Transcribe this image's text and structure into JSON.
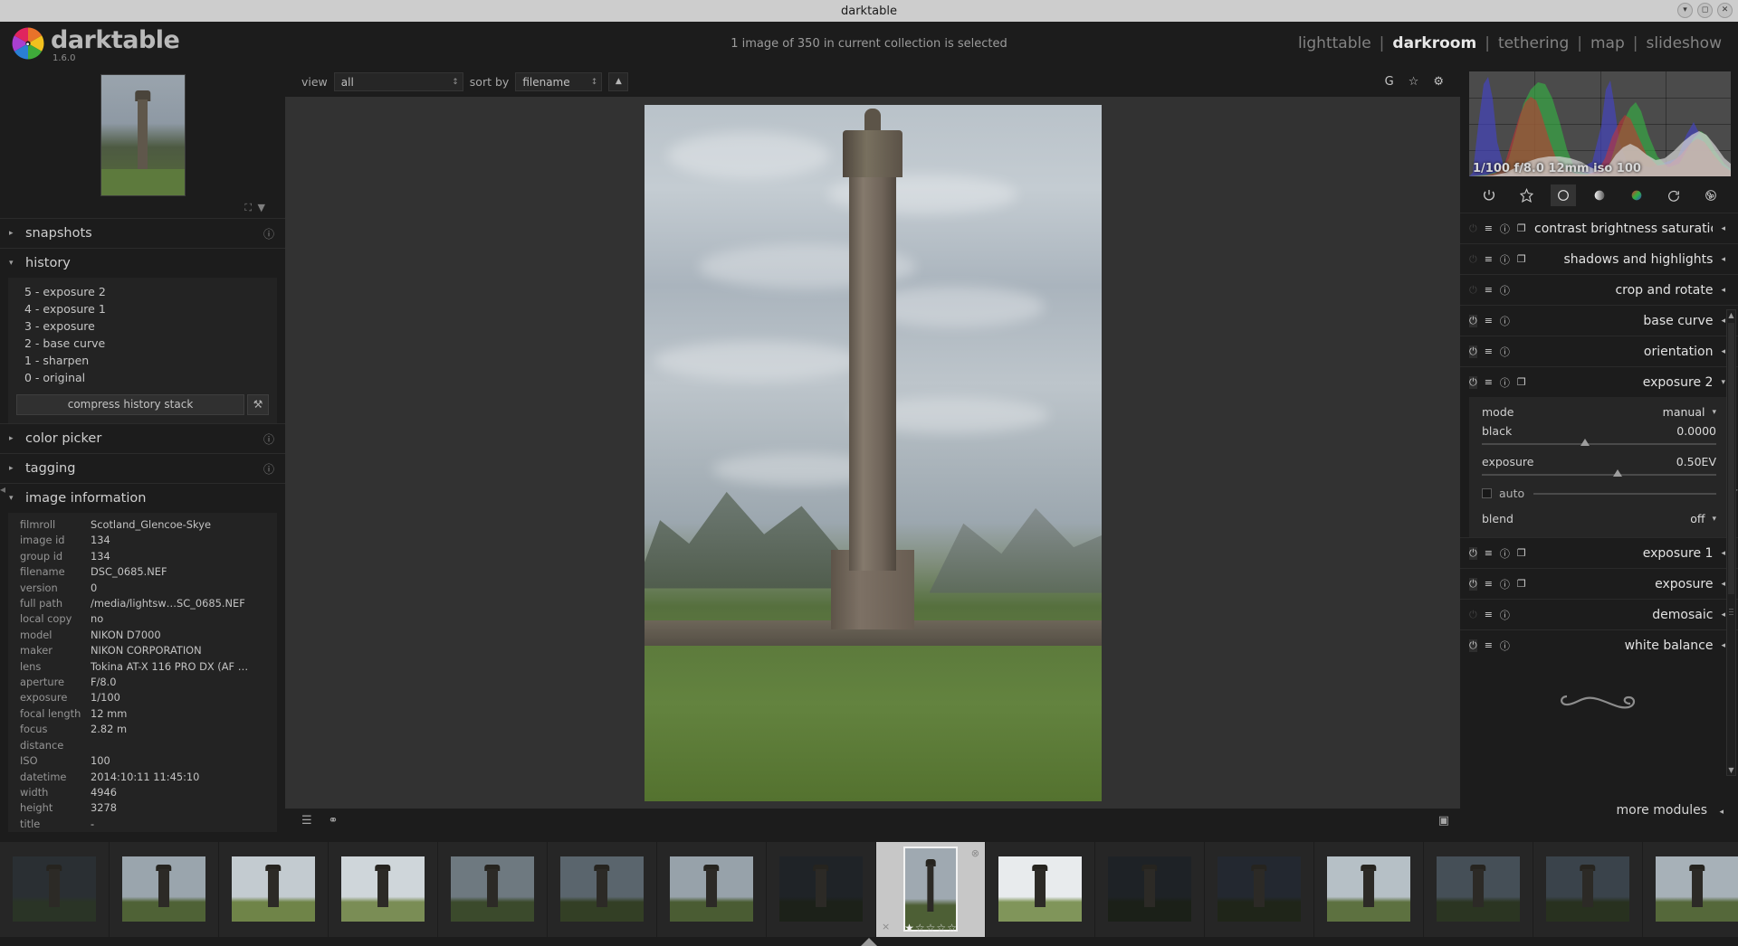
{
  "window": {
    "title": "darktable"
  },
  "header": {
    "app_name": "darktable",
    "version": "1.6.0",
    "collection_status": "1 image of 350 in current collection is selected",
    "views": [
      {
        "label": "lighttable",
        "active": false
      },
      {
        "label": "darkroom",
        "active": true
      },
      {
        "label": "tethering",
        "active": false
      },
      {
        "label": "map",
        "active": false
      },
      {
        "label": "slideshow",
        "active": false
      }
    ],
    "separator": "|"
  },
  "left_panel": {
    "navigation": {
      "fit_label": "fit-icon",
      "dropdown": "▼"
    },
    "snapshots": {
      "title": "snapshots",
      "triangle": "▸",
      "reset_icon": "reset-icon"
    },
    "history": {
      "title": "history",
      "triangle": "▾",
      "items": [
        "5 - exposure 2",
        "4 - exposure 1",
        "3 - exposure",
        "2 - base curve",
        "1 - sharpen",
        "0 - original"
      ],
      "compress_button": "compress history stack",
      "compress_icon": "duplicate-icon"
    },
    "color_picker": {
      "title": "color picker",
      "triangle": "▸",
      "reset_icon": "reset-icon"
    },
    "tagging": {
      "title": "tagging",
      "triangle": "▸",
      "reset_icon": "reset-icon"
    },
    "image_information": {
      "title": "image information",
      "triangle": "▾",
      "rows": [
        {
          "key": "filmroll",
          "value": "Scotland_Glencoe-Skye"
        },
        {
          "key": "image id",
          "value": "134"
        },
        {
          "key": "group id",
          "value": "134"
        },
        {
          "key": "filename",
          "value": "DSC_0685.NEF"
        },
        {
          "key": "version",
          "value": "0"
        },
        {
          "key": "full path",
          "value": "/media/lightsw…SC_0685.NEF"
        },
        {
          "key": "local copy",
          "value": "no"
        },
        {
          "key": "model",
          "value": "NIKON D7000"
        },
        {
          "key": "maker",
          "value": "NIKON CORPORATION"
        },
        {
          "key": "lens",
          "value": "Tokina AT-X 116 PRO DX (AF …"
        },
        {
          "key": "aperture",
          "value": "F/8.0"
        },
        {
          "key": "exposure",
          "value": "1/100"
        },
        {
          "key": "focal length",
          "value": "12 mm"
        },
        {
          "key": "focus distance",
          "value": "2.82 m"
        },
        {
          "key": "ISO",
          "value": "100"
        },
        {
          "key": "datetime",
          "value": "2014:10:11 11:45:10"
        },
        {
          "key": "width",
          "value": "4946"
        },
        {
          "key": "height",
          "value": "3278"
        },
        {
          "key": "title",
          "value": "-"
        }
      ]
    }
  },
  "center": {
    "toolbar": {
      "view_label": "view",
      "view_value": "all",
      "sort_label": "sort by",
      "sort_value": "filename",
      "sort_direction": "▲",
      "grouping_icon": "G",
      "overlays_icon": "☆",
      "preferences_icon": "⚙"
    },
    "bottom": {
      "filmstrip_toggle_icon": "hamburger-icon",
      "duplicate_icon": "duplicate-icon",
      "focus_icon": "focus-peaking-icon"
    }
  },
  "right_panel": {
    "histogram": {
      "overlay": "1/100 f/8.0 12mm iso 100",
      "channels": [
        "red",
        "green",
        "blue"
      ]
    },
    "module_groups": [
      {
        "name": "active-group-icon",
        "glyph": "⏻",
        "selected": false
      },
      {
        "name": "favorites-group-icon",
        "glyph": "✦",
        "selected": false
      },
      {
        "name": "basic-group-icon",
        "glyph": "◯",
        "selected": true
      },
      {
        "name": "tone-group-icon",
        "glyph": "◕",
        "selected": false
      },
      {
        "name": "color-group-icon",
        "glyph": "●",
        "selected": false
      },
      {
        "name": "correction-group-icon",
        "glyph": "↺",
        "selected": false
      },
      {
        "name": "effects-group-icon",
        "glyph": "✻",
        "selected": false
      }
    ],
    "modules": [
      {
        "label": "contrast brightness saturation",
        "power": false,
        "multi": true,
        "expanded": false,
        "triangle": "◂"
      },
      {
        "label": "shadows and highlights",
        "power": false,
        "multi": true,
        "expanded": false,
        "triangle": "◂"
      },
      {
        "label": "crop and rotate",
        "power": false,
        "multi": false,
        "expanded": false,
        "triangle": "◂"
      },
      {
        "label": "base curve",
        "power": true,
        "multi": false,
        "expanded": false,
        "triangle": "◂"
      },
      {
        "label": "orientation",
        "power": true,
        "multi": false,
        "expanded": false,
        "triangle": "◂"
      },
      {
        "label": "exposure 2",
        "power": true,
        "multi": true,
        "expanded": true,
        "triangle": "▾"
      }
    ],
    "exposure_panel": {
      "mode_label": "mode",
      "mode_value": "manual",
      "black_label": "black",
      "black_value": "0.0000",
      "black_slider_pct": 44,
      "exposure_label": "exposure",
      "exposure_value": "0.50EV",
      "exposure_slider_pct": 58,
      "auto_label": "auto",
      "auto_checked": false,
      "blend_label": "blend",
      "blend_value": "off"
    },
    "modules_after": [
      {
        "label": "exposure 1",
        "power": true,
        "multi": true,
        "expanded": false,
        "triangle": "◂"
      },
      {
        "label": "exposure",
        "power": true,
        "multi": true,
        "expanded": false,
        "triangle": "◂"
      },
      {
        "label": "demosaic",
        "power": false,
        "multi": false,
        "expanded": false,
        "triangle": "◂"
      },
      {
        "label": "white balance",
        "power": true,
        "multi": false,
        "expanded": false,
        "triangle": "◂"
      }
    ],
    "more_modules": {
      "label": "more modules",
      "triangle": "◂"
    }
  },
  "filmstrip": {
    "selected_index": 8,
    "items": [
      {
        "tone": "dark",
        "sky": "#2a2f33",
        "ground": "#2a3426"
      },
      {
        "tone": "normal",
        "sky": "#9aa5ad",
        "ground": "#4f6236"
      },
      {
        "tone": "bright",
        "sky": "#c3cbd0",
        "ground": "#6f8448"
      },
      {
        "tone": "bright",
        "sky": "#cfd6da",
        "ground": "#7a8d55"
      },
      {
        "tone": "dark",
        "sky": "#6e7980",
        "ground": "#3b4a2c"
      },
      {
        "tone": "dark",
        "sky": "#5a656d",
        "ground": "#333f25"
      },
      {
        "tone": "normal",
        "sky": "#97a2aa",
        "ground": "#4a5c33"
      },
      {
        "tone": "verydark",
        "sky": "#1f2327",
        "ground": "#1c2119"
      },
      {
        "tone": "selected",
        "sky": "#9fa9b1",
        "ground": "#4d5f35"
      },
      {
        "tone": "white",
        "sky": "#e8ebed",
        "ground": "#80955a"
      },
      {
        "tone": "verydark",
        "sky": "#1e2226",
        "ground": "#1b2018"
      },
      {
        "tone": "verydark",
        "sky": "#232830",
        "ground": "#1f2519"
      },
      {
        "tone": "normal",
        "sky": "#b6c0c6",
        "ground": "#5d7140"
      },
      {
        "tone": "dark",
        "sky": "#454f57",
        "ground": "#2b3522"
      },
      {
        "tone": "dark",
        "sky": "#3a434b",
        "ground": "#28311f"
      },
      {
        "tone": "normal",
        "sky": "#a7b1b8",
        "ground": "#55683a"
      },
      {
        "tone": "normal",
        "sky": "#9dabb4",
        "ground": "#506438"
      }
    ],
    "rating": {
      "filled": 1,
      "total": 5,
      "star_glyph": "★",
      "empty_glyph": "☆"
    },
    "reject_glyph": "×",
    "altered_glyph": "⊗"
  },
  "colors": {
    "background": "#1c1c1c",
    "panel": "#232323",
    "canvas": "#323232",
    "accent_text": "#e8e8e8",
    "histogram_bg": "#4b4b4b",
    "titlebar": "#cdcdcd"
  }
}
